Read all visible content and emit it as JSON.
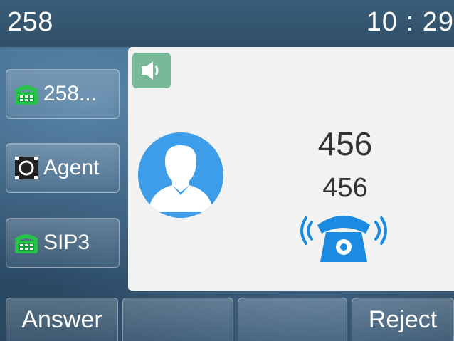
{
  "status_bar": {
    "title": "258",
    "time": "10 : 29"
  },
  "line_keys": [
    {
      "label": "258...",
      "icon": "green-phone-icon"
    },
    {
      "label": "Agent",
      "icon": "agent-icon"
    },
    {
      "label": "SIP3",
      "icon": "green-phone-icon"
    }
  ],
  "call": {
    "mode_icon": "speaker-icon",
    "avatar_icon": "contact-avatar-icon",
    "name": "456",
    "number": "456",
    "state_icon": "ringing-phone-icon"
  },
  "softkeys": [
    {
      "label": "Answer"
    },
    {
      "label": ""
    },
    {
      "label": ""
    },
    {
      "label": "Reject"
    }
  ],
  "colors": {
    "accent_blue": "#1a8be0",
    "speaker_badge": "#7ab89a",
    "line_green": "#26c24a",
    "panel_bg": "#f2f2f2"
  }
}
